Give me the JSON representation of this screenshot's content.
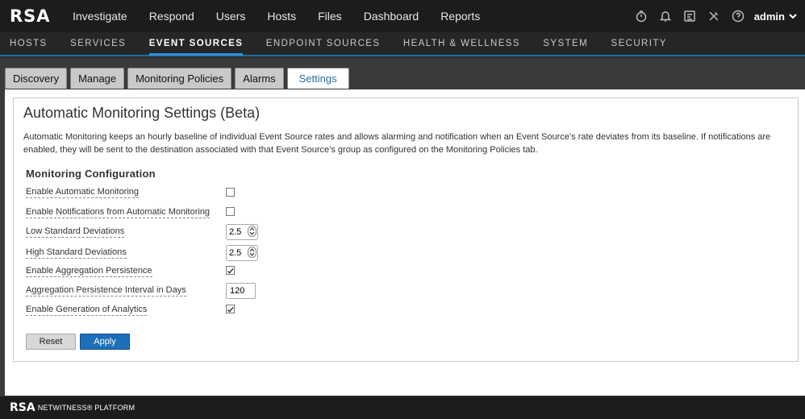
{
  "brand": {
    "logo": "RSA"
  },
  "top_nav": [
    "Investigate",
    "Respond",
    "Users",
    "Hosts",
    "Files",
    "Dashboard",
    "Reports"
  ],
  "top_icons": [
    "timer-icon",
    "bell-icon",
    "tasks-icon",
    "tools-icon",
    "help-icon"
  ],
  "user": {
    "name": "admin"
  },
  "sub_nav": [
    {
      "label": "HOSTS",
      "active": false
    },
    {
      "label": "SERVICES",
      "active": false
    },
    {
      "label": "EVENT SOURCES",
      "active": true
    },
    {
      "label": "ENDPOINT SOURCES",
      "active": false
    },
    {
      "label": "HEALTH & WELLNESS",
      "active": false
    },
    {
      "label": "SYSTEM",
      "active": false
    },
    {
      "label": "SECURITY",
      "active": false
    }
  ],
  "tabs": [
    {
      "label": "Discovery",
      "active": false
    },
    {
      "label": "Manage",
      "active": false
    },
    {
      "label": "Monitoring Policies",
      "active": false
    },
    {
      "label": "Alarms",
      "active": false
    },
    {
      "label": "Settings",
      "active": true
    }
  ],
  "panel": {
    "title": "Automatic Monitoring Settings (Beta)",
    "description": "Automatic Monitoring keeps an hourly baseline of individual Event Source rates and allows alarming and notification when an Event Source’s rate deviates from its baseline. If notifications are enabled, they will be sent to the destination associated with that Event Source’s group as configured on the Monitoring Policies tab.",
    "section_title": "Monitoring Configuration"
  },
  "settings": {
    "enable_auto_monitoring": {
      "label": "Enable Automatic Monitoring",
      "checked": false
    },
    "enable_notifications": {
      "label": "Enable Notifications from Automatic Monitoring",
      "checked": false
    },
    "low_std_dev": {
      "label": "Low Standard Deviations",
      "value": "2.5"
    },
    "high_std_dev": {
      "label": "High Standard Deviations",
      "value": "2.5"
    },
    "enable_agg_persistence": {
      "label": "Enable Aggregation Persistence",
      "checked": true
    },
    "agg_interval": {
      "label": "Aggregation Persistence Interval in Days",
      "value": "120"
    },
    "enable_analytics": {
      "label": "Enable Generation of Analytics",
      "checked": true
    }
  },
  "buttons": {
    "reset": "Reset",
    "apply": "Apply"
  },
  "footer": {
    "logo": "RSA",
    "product": "NETWITNESS® PLATFORM"
  },
  "colors": {
    "accent": "#2d8fd5",
    "apply_button": "#1d6fb8",
    "topbar": "#1c1c1c"
  }
}
